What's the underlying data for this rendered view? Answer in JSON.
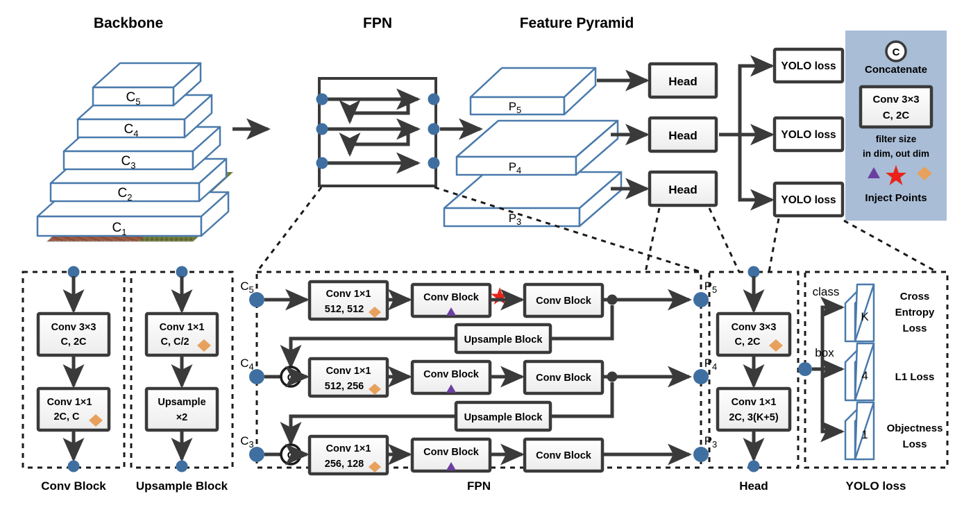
{
  "colors": {
    "slab_stroke": "#4A7AAC",
    "node_blue": "#3F6FA0",
    "dark": "#3A3A3A",
    "box_fill": "#F5F5F5",
    "legend_bg": "#A9BDD6",
    "diamond": "#E8A15C",
    "triangle": "#6B3FA0",
    "star": "#E8231A",
    "roof": "#9C5B42",
    "veg": "#6E7A3A"
  },
  "titles": {
    "backbone": "Backbone",
    "fpn": "FPN",
    "feature_pyramid": "Feature Pyramid"
  },
  "backbone": {
    "layers": [
      {
        "label": "C",
        "sub": "5"
      },
      {
        "label": "C",
        "sub": "4"
      },
      {
        "label": "C",
        "sub": "3"
      },
      {
        "label": "C",
        "sub": "2"
      },
      {
        "label": "C",
        "sub": "1"
      }
    ]
  },
  "feature_pyramid": {
    "layers": [
      {
        "label": "P",
        "sub": "5"
      },
      {
        "label": "P",
        "sub": "4"
      },
      {
        "label": "P",
        "sub": "3"
      }
    ]
  },
  "heads": [
    {
      "label": "Head"
    },
    {
      "label": "Head"
    },
    {
      "label": "Head"
    }
  ],
  "yolo_losses": [
    {
      "label": "YOLO loss"
    },
    {
      "label": "YOLO loss"
    },
    {
      "label": "YOLO loss"
    }
  ],
  "legend": {
    "concat_symbol": "C",
    "concat_label": "Concatenate",
    "conv_line1": "Conv 3×3",
    "conv_line2": "C, 2C",
    "desc_line1": "filter size",
    "desc_line2": "in dim, out dim",
    "inject_label": "Inject Points",
    "markers": [
      "triangle-marker",
      "star-marker",
      "diamond-marker"
    ]
  },
  "conv_block_panel": {
    "caption": "Conv Block",
    "boxes": [
      {
        "line1": "Conv 3×3",
        "line2": "C, 2C",
        "marker": ""
      },
      {
        "line1": "Conv 1×1",
        "line2": "2C, C",
        "marker": "diamond"
      }
    ]
  },
  "upsample_block_panel": {
    "caption": "Upsample Block",
    "boxes": [
      {
        "line1": "Conv 1×1",
        "line2": "C, C/2",
        "marker": "diamond"
      },
      {
        "line1": "Upsample",
        "line2": "×2",
        "marker": ""
      }
    ]
  },
  "fpn_panel": {
    "caption": "FPN",
    "inputs": [
      {
        "label": "C",
        "sub": "5"
      },
      {
        "label": "C",
        "sub": "4"
      },
      {
        "label": "C",
        "sub": "3"
      }
    ],
    "outputs": [
      {
        "label": "P",
        "sub": "5"
      },
      {
        "label": "P",
        "sub": "4"
      },
      {
        "label": "P",
        "sub": "3"
      }
    ],
    "rows": [
      {
        "conv_line1": "Conv 1×1",
        "conv_line2": "512, 512",
        "conv_marker": "diamond",
        "block1": "Conv Block",
        "block1_marker": "triangle",
        "mid_marker": "star",
        "block2": "Conv Block",
        "has_concat": false
      },
      {
        "conv_line1": "Conv 1×1",
        "conv_line2": "512, 256",
        "conv_marker": "diamond",
        "block1": "Conv Block",
        "block1_marker": "triangle",
        "mid_marker": "",
        "block2": "Conv Block",
        "has_concat": true,
        "concat_symbol": "C"
      },
      {
        "conv_line1": "Conv 1×1",
        "conv_line2": "256, 128",
        "conv_marker": "diamond",
        "block1": "Conv Block",
        "block1_marker": "triangle",
        "mid_marker": "",
        "block2": "Conv Block",
        "has_concat": true,
        "concat_symbol": "C"
      }
    ],
    "upsample_blocks": [
      {
        "label": "Upsample Block"
      },
      {
        "label": "Upsample Block"
      }
    ]
  },
  "head_panel": {
    "caption": "Head",
    "boxes": [
      {
        "line1": "Conv 3×3",
        "line2": "C, 2C",
        "marker": "diamond"
      },
      {
        "line1": "Conv 1×1",
        "line2": "2C, 3(K+5)",
        "marker": ""
      }
    ]
  },
  "yolo_loss_panel": {
    "caption": "YOLO loss",
    "branches": [
      {
        "arrow_label": "class",
        "slab_value": "K",
        "loss_lines": [
          "Cross",
          "Entropy",
          "Loss"
        ]
      },
      {
        "arrow_label": "box",
        "slab_value": "4",
        "loss_lines": [
          "L1 Loss"
        ]
      },
      {
        "arrow_label": "",
        "slab_value": "1",
        "loss_lines": [
          "Objectness",
          "Loss"
        ]
      }
    ]
  }
}
